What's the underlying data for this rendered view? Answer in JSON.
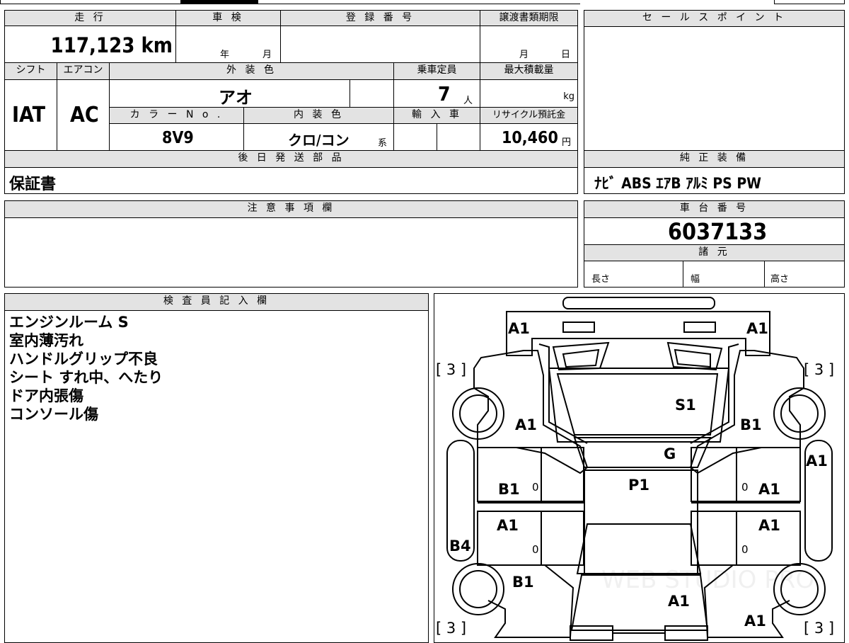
{
  "top": {
    "mileage_label": "走 行",
    "mileage_value": "117,123 km",
    "shaken_label": "車 検",
    "shaken_year": "年",
    "shaken_month": "月",
    "reg_label": "登 録 番 号",
    "deadline_label": "譲渡書類期限",
    "deadline_month": "月",
    "deadline_day": "日",
    "shift_label": "シフト",
    "shift_value": "IAT",
    "ac_label": "エアコン",
    "ac_value": "AC",
    "ext_color_label": "外 装 色",
    "ext_color_value": "アオ",
    "capacity_label": "乗車定員",
    "capacity_value": "7",
    "capacity_unit": "人",
    "load_label": "最大積載量",
    "load_unit": "kg",
    "color_no_label": "カ ラ ー N o .",
    "color_no_value": "8V9",
    "int_color_label": "内 装 色",
    "int_color_value": "クロ/コン",
    "int_color_suffix": "系",
    "import_label": "輸 入 車",
    "recycle_label": "リサイクル預託金",
    "recycle_value": "10,460",
    "recycle_unit": "円",
    "later_parts_label": "後 日 発 送 部 品",
    "later_parts_value": "保証書"
  },
  "sales": {
    "label": "セ ー ル ス ポ イ ン ト",
    "equipment_label": "純 正 装 備",
    "equipment_value": "ﾅﾋﾞ ABS ｴｱB ｱﾙﾐ PS PW"
  },
  "notes": {
    "label": "注 意 事 項 欄"
  },
  "chassis": {
    "label": "車 台 番 号",
    "value": "6037133",
    "spec_label": "諸 元",
    "length_label": "長さ",
    "width_label": "幅",
    "height_label": "高さ"
  },
  "inspector": {
    "label": "検 査 員 記 入 欄",
    "lines": [
      "エンジンルーム S",
      "室内薄汚れ",
      "ハンドルグリップ不良",
      "シート すれ中、へたり",
      "ドア内張傷",
      "コンソール傷"
    ]
  },
  "diagram": {
    "watermark": "WEB STUDIO PRO",
    "marks": {
      "front_left": "A1",
      "front_right": "A1",
      "bracket_tl": "[ 3 ]",
      "bracket_tr": "[ 3 ]",
      "bracket_bl": "[ 3 ]",
      "bracket_br": "[ 3 ]",
      "windshield": "S1",
      "fender_left": "A1",
      "fender_right": "B1",
      "hood_g": "G",
      "roof": "P1",
      "mirror_right": "A1",
      "front_door_left": "B1",
      "front_door_left_zero": "0",
      "front_door_right_zero": "0",
      "front_door_right": "A1",
      "rear_door_left": "A1",
      "rear_door_right": "A1",
      "rear_zero_left": "0",
      "rear_zero_right": "0",
      "sill_left": "B4",
      "quarter_left": "B1",
      "rear_center": "A1",
      "rear_right": "A1"
    }
  }
}
